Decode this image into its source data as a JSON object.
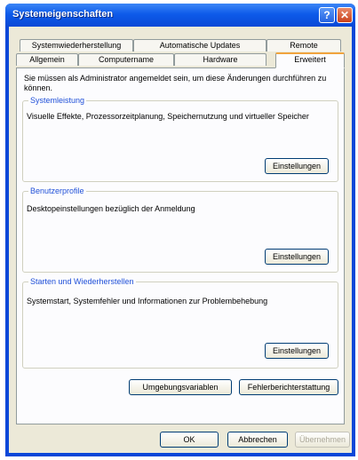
{
  "window": {
    "title": "Systemeigenschaften",
    "help": "?",
    "close": "✕"
  },
  "tabs": {
    "back_row": [
      "Systemwiederherstellung",
      "Automatische Updates",
      "Remote"
    ],
    "front_row": [
      "Allgemein",
      "Computername",
      "Hardware",
      "Erweitert"
    ],
    "active": "Erweitert"
  },
  "intro": "Sie müssen als Administrator angemeldet sein, um diese Änderungen durchführen zu können.",
  "groups": [
    {
      "title": "Systemleistung",
      "description": "Visuelle Effekte, Prozessorzeitplanung, Speichernutzung und virtueller Speicher",
      "button": "Einstellungen"
    },
    {
      "title": "Benutzerprofile",
      "description": "Desktopeinstellungen bezüglich der Anmeldung",
      "button": "Einstellungen"
    },
    {
      "title": "Starten und Wiederherstellen",
      "description": "Systemstart, Systemfehler und Informationen zur Problembehebung",
      "button": "Einstellungen"
    }
  ],
  "buttons": {
    "env_vars": "Umgebungsvariablen",
    "error_report": "Fehlerberichterstattung",
    "ok": "OK",
    "cancel": "Abbrechen",
    "apply": "Übernehmen"
  },
  "colors": {
    "titlebar": "#0848d6",
    "active_tab_accent": "#f0a43e",
    "group_title": "#2050d8"
  }
}
